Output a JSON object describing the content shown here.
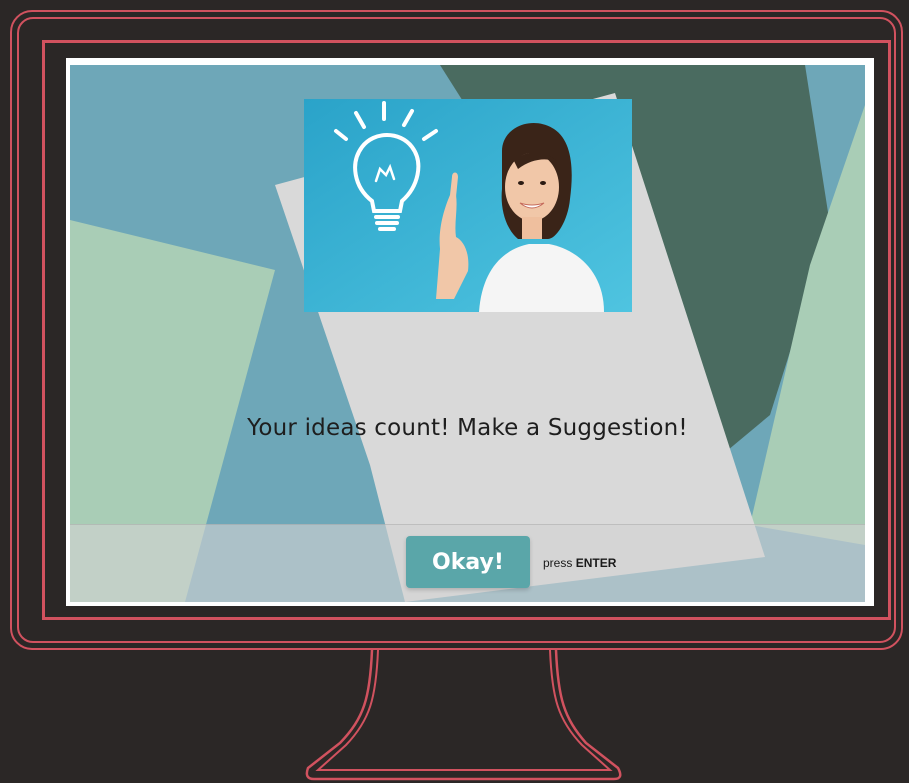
{
  "prompt": {
    "headline": "Your ideas count! Make a Suggestion!",
    "button_label": "Okay!",
    "hint_prefix": "press",
    "hint_key": "ENTER"
  },
  "image": {
    "subject": "smiling woman pointing at lightbulb illustration",
    "icon": "lightbulb-icon"
  },
  "colors": {
    "outline": "#d1525f",
    "background": "#2b2726",
    "button": "#5aa6a9",
    "panel": "#d9d9d9",
    "teal": "#6ea7b8",
    "dark_green": "#4a6b60",
    "light_green": "#a9cdb6"
  }
}
